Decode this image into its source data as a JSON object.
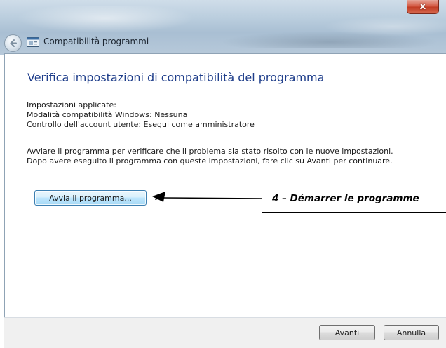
{
  "window": {
    "title": "Compatibilità programmi",
    "close_glyph": "x"
  },
  "icons": {
    "back": "back-arrow-icon",
    "app": "program-window-icon",
    "close": "close-icon"
  },
  "main": {
    "heading": "Verifica impostazioni di compatibilità del programma",
    "settings_lines": [
      "Impostazioni applicate:",
      "Modalità compatibilità Windows: Nessuna",
      "Controllo dell'account utente:  Esegui come amministratore"
    ],
    "description_lines": [
      "Avviare il programma per verificare che il problema sia stato risolto con le nuove impostazioni.",
      "Dopo avere eseguito il programma con queste impostazioni, fare clic su Avanti per continuare."
    ],
    "run_button_label": "Avvia il programma..."
  },
  "annotation": {
    "text": "4 – Démarrer le programme"
  },
  "footer": {
    "next_label": "Avanti",
    "cancel_label": "Annulla"
  },
  "colors": {
    "heading": "#1e3d8a",
    "close_button": "#c13c24",
    "footer_bg": "#f0f0f0"
  }
}
